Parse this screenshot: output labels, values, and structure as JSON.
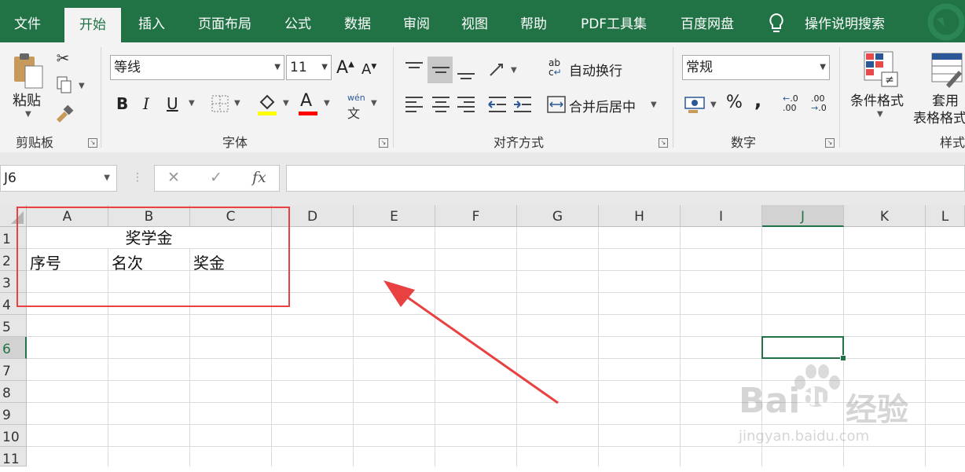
{
  "tabs": [
    {
      "key": "file",
      "label": "文件"
    },
    {
      "key": "home",
      "label": "开始",
      "active": true
    },
    {
      "key": "insert",
      "label": "插入"
    },
    {
      "key": "layout",
      "label": "页面布局"
    },
    {
      "key": "formulas",
      "label": "公式"
    },
    {
      "key": "data",
      "label": "数据"
    },
    {
      "key": "review",
      "label": "审阅"
    },
    {
      "key": "view",
      "label": "视图"
    },
    {
      "key": "help",
      "label": "帮助"
    },
    {
      "key": "pdf",
      "label": "PDF工具集"
    },
    {
      "key": "baidu",
      "label": "百度网盘"
    }
  ],
  "tell_me": "操作说明搜索",
  "ribbon": {
    "clipboard": {
      "paste_label": "粘贴",
      "group_label": "剪贴板"
    },
    "font": {
      "font_name": "等线",
      "font_size": "11",
      "group_label": "字体",
      "bold": "B",
      "italic": "I",
      "underline": "U",
      "grow": "A",
      "shrink": "A",
      "font_color_glyph": "A",
      "phonetic_top": "wén",
      "phonetic_bottom": "文",
      "fill_color": "#ffff00",
      "font_color": "#ff0000"
    },
    "alignment": {
      "wrap_text": "自动换行",
      "merge_center": "合并后居中",
      "group_label": "对齐方式",
      "wrap_icon_top": "ab",
      "wrap_icon_bottom": "c"
    },
    "number": {
      "format": "常规",
      "group_label": "数字",
      "percent": "%",
      "comma": ",",
      "inc_decimal_top": ".0",
      "inc_decimal_bottom": ".00",
      "inc_decimal_arrow": "←",
      "dec_decimal_top": ".00",
      "dec_decimal_bottom": ".0",
      "dec_decimal_arrow": "→"
    },
    "styles": {
      "conditional_format": "条件格式",
      "format_as_table_1": "套用",
      "format_as_table_2": "表格格式",
      "group_label": "样式"
    }
  },
  "formula_bar": {
    "name_box": "J6",
    "cancel": "✕",
    "enter": "✓",
    "fx": "fx",
    "value": ""
  },
  "columns": [
    "A",
    "B",
    "C",
    "D",
    "E",
    "F",
    "G",
    "H",
    "I",
    "J",
    "K",
    "L"
  ],
  "selected_column": "J",
  "rows": [
    "1",
    "2",
    "3",
    "4",
    "5",
    "6",
    "7",
    "8",
    "9",
    "10",
    "11"
  ],
  "selected_row": "6",
  "cells": {
    "A1_merged": "奖学金",
    "A2": "序号",
    "B2": "名次",
    "C2": "奖金"
  },
  "annotation_color": "#e94141",
  "watermark": {
    "line1": "Bai",
    "line1b": "du",
    "line1c": "经验",
    "line2": "jingyan.baidu.com"
  },
  "colors": {
    "accent": "#217346",
    "ribbon_bg": "#f3f3f3",
    "header_bg": "#e6e6e6"
  }
}
